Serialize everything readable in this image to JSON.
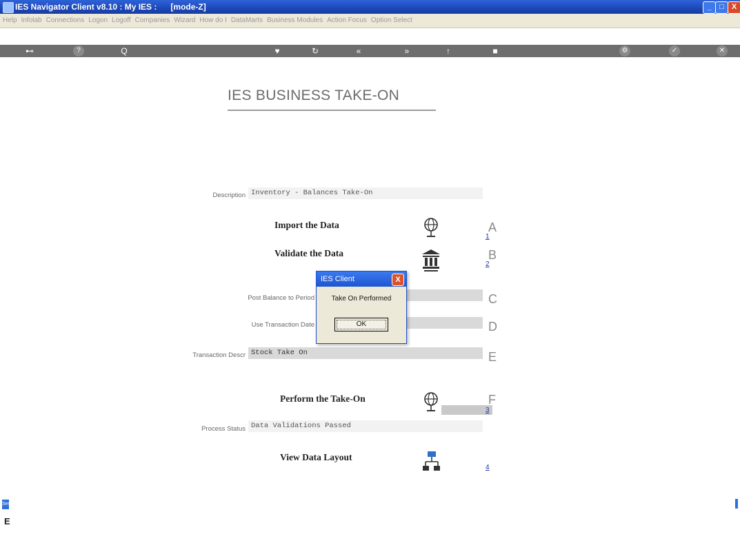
{
  "window": {
    "title": "IES Navigator Client v8.10 : My IES :      [mode-Z]",
    "controls": {
      "minimize": "_",
      "maximize": "□",
      "close": "X"
    }
  },
  "menu": [
    "Help",
    "Infolab",
    "Connections",
    "Logon",
    "Logoff",
    "Companies",
    "Wizard",
    "How do I",
    "DataMarts",
    "Business Modules",
    "Action Focus",
    "Option Select"
  ],
  "toolbar": {
    "icons": [
      "key-icon",
      "help-icon",
      "search-icon",
      "heart-icon",
      "refresh-icon",
      "back-icon",
      "forward-icon",
      "up-icon",
      "home-icon",
      "gear-icon",
      "check-icon",
      "close-icon"
    ],
    "glyphs": {
      "key": "⊷",
      "help": "?",
      "search": "Q",
      "heart": "♥",
      "refresh": "↻",
      "back": "«",
      "forward": "»",
      "up": "↑",
      "home": "■",
      "gear": "⚙",
      "check": "✓",
      "close": "✕"
    }
  },
  "page": {
    "title": "IES BUSINESS TAKE-ON",
    "description_label": "Description",
    "description_value": "Inventory - Balances Take-On",
    "import_label": "Import the Data",
    "import_step": "A",
    "import_link": "1",
    "validate_label": "Validate the Data",
    "validate_step": "B",
    "validate_link": "2",
    "post_balance_label": "Post Balance to Period",
    "post_balance_step": "C",
    "use_trans_label": "Use Transaction Date",
    "use_trans_step": "D",
    "trans_descr_label": "Transaction Descr",
    "trans_descr_value": "Stock Take On",
    "trans_descr_step": "E",
    "perform_label": "Perform the Take-On",
    "perform_step": "F",
    "perform_link": "3",
    "process_status_label": "Process Status",
    "process_status_value": "Data Validations Passed",
    "view_layout_label": "View Data Layout",
    "view_layout_link": "4"
  },
  "dialog": {
    "title": "IES Client",
    "message": "Take On Performed",
    "ok_label": "OK",
    "close_glyph": "X"
  },
  "bottom": {
    "badge": "Ses",
    "glyph": "E"
  },
  "colors": {
    "titlebar": "#1d48b8",
    "toolbar": "#6e6e6e",
    "accent_link": "#2233aa"
  }
}
